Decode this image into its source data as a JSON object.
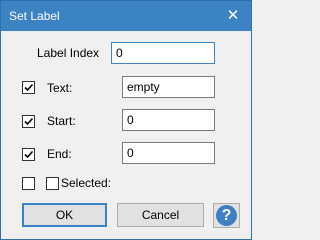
{
  "window": {
    "title": "Set Label",
    "close_glyph": "✕"
  },
  "form": {
    "label_index": {
      "label": "Label Index",
      "value": "0"
    },
    "text": {
      "label": "Text:",
      "value": "empty",
      "checked": true
    },
    "start": {
      "label": "Start:",
      "value": "0",
      "checked": true
    },
    "end": {
      "label": "End:",
      "value": "0",
      "checked": true
    },
    "selected": {
      "label": "Selected:",
      "outer_checked": false,
      "inner_checked": false
    }
  },
  "buttons": {
    "ok_label": "OK",
    "cancel_label": "Cancel",
    "help_glyph": "?"
  },
  "colors": {
    "titlebar": "#3c83c3",
    "accent": "#3c83c3",
    "help_icon": "#3d7fc4"
  },
  "icons": [
    "close-icon",
    "checkmark-icon",
    "help-icon"
  ]
}
